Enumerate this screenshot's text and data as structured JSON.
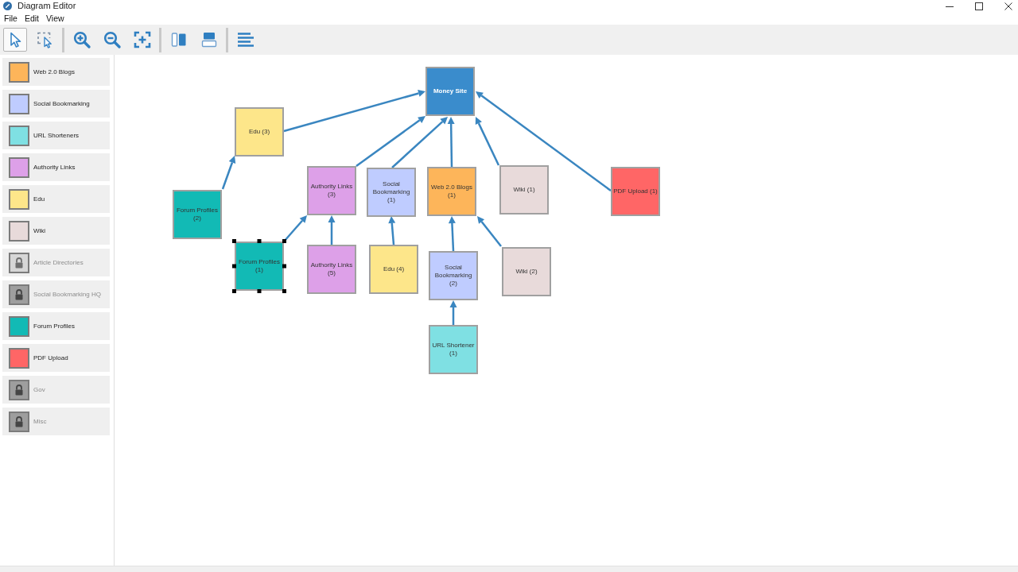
{
  "window": {
    "title": "Diagram Editor"
  },
  "menu": [
    "File",
    "Edit",
    "View"
  ],
  "toolbar": {
    "groups": [
      {
        "buttons": [
          {
            "kind": "pointer",
            "selected": true
          },
          {
            "kind": "marquee",
            "selected": false
          }
        ]
      },
      {
        "buttons": [
          {
            "kind": "zoom_in"
          },
          {
            "kind": "zoom_out"
          },
          {
            "kind": "zoom_fit"
          }
        ]
      },
      {
        "buttons": [
          {
            "kind": "align_columns"
          },
          {
            "kind": "align_rows"
          }
        ]
      },
      {
        "buttons": [
          {
            "kind": "align_left"
          }
        ]
      }
    ]
  },
  "sidebar": {
    "items": [
      {
        "label": "Web 2.0 Blogs",
        "color": "#fdb55a",
        "locked": false
      },
      {
        "label": "Social Bookmarking",
        "color": "#bfccff",
        "locked": false
      },
      {
        "label": "URL Shorteners",
        "color": "#7fe0e3",
        "locked": false
      },
      {
        "label": "Authority Links",
        "color": "#dda0e8",
        "locked": false
      },
      {
        "label": "Edu",
        "color": "#fde68a",
        "locked": false
      },
      {
        "label": "Wiki",
        "color": "#e8dada",
        "locked": false
      },
      {
        "label": "Article Directories",
        "color": "#d6d6d6",
        "locked": true
      },
      {
        "label": "Social Bookmarking HQ",
        "color": "#9e9e9e",
        "locked": true
      },
      {
        "label": "Forum Profiles",
        "color": "#12bab5",
        "locked": false
      },
      {
        "label": "PDF Upload",
        "color": "#ff6666",
        "locked": false
      },
      {
        "label": "Gov",
        "color": "#9e9e9e",
        "locked": true
      },
      {
        "label": "Misc",
        "color": "#9e9e9e",
        "locked": true
      }
    ]
  },
  "diagram": {
    "nodes": [
      {
        "label": "Money Site",
        "color": "#3a8ccc",
        "selected": false,
        "children": [
          {
            "label": "Edu (3)",
            "color": "#fde68a",
            "selected": false,
            "children": [
              {
                "label": "Forum Profiles (2)",
                "color": "#12bab5",
                "selected": false
              }
            ]
          },
          {
            "label": "Authority Links (3)",
            "color": "#dda0e8",
            "selected": false,
            "children": [
              {
                "label": "Forum Profiles (1)",
                "color": "#12bab5",
                "selected": true
              },
              {
                "label": "Authority Links (5)",
                "color": "#dda0e8",
                "selected": false
              }
            ]
          },
          {
            "label": "Social Bookmarking (1)",
            "color": "#bfccff",
            "selected": false,
            "children": [
              {
                "label": "Edu (4)",
                "color": "#fde68a",
                "selected": false
              }
            ]
          },
          {
            "label": "Web 2.0 Blogs (1)",
            "color": "#fdb55a",
            "selected": false,
            "children": [
              {
                "label": "Social Bookmarking (2)",
                "color": "#bfccff",
                "selected": false,
                "children": [
                  {
                    "label": "URL Shortener (1)",
                    "color": "#7fe0e3",
                    "selected": false
                  }
                ]
              },
              {
                "label": "Wiki (2)",
                "color": "#e8dada",
                "selected": false
              }
            ]
          },
          {
            "label": "Wiki (1)",
            "color": "#e8dada",
            "selected": false
          },
          {
            "label": "PDF Upload (1)",
            "color": "#ff6666",
            "selected": false
          }
        ]
      }
    ]
  }
}
